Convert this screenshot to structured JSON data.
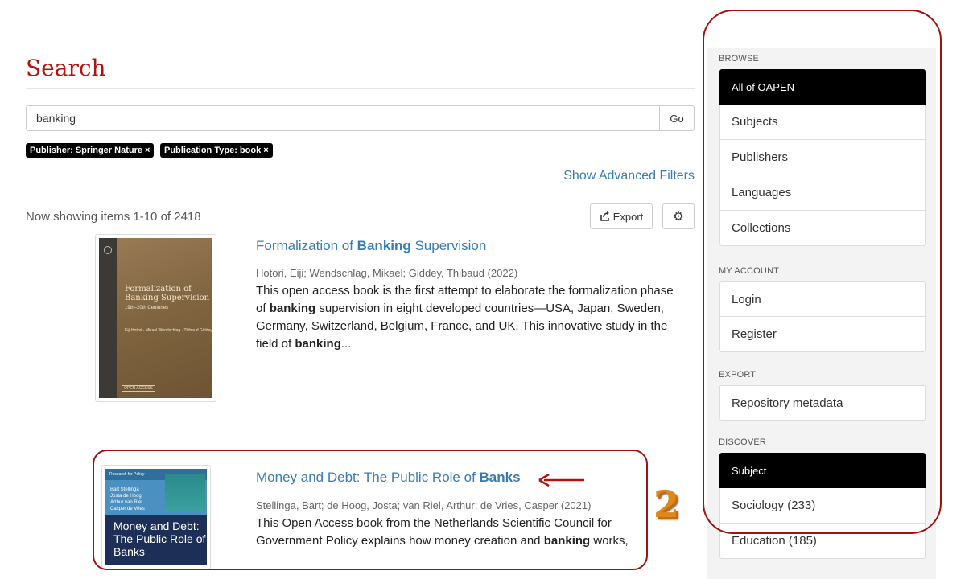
{
  "header": {
    "title": "Search"
  },
  "search": {
    "value": "banking",
    "go_label": "Go"
  },
  "filters": [
    {
      "label": "Publisher: Springer Nature ×"
    },
    {
      "label": "Publication Type: book ×"
    }
  ],
  "advanced_filters_label": "Show Advanced Filters",
  "results_info": "Now showing items 1-10 of 2418",
  "toolbar": {
    "export_label": "Export"
  },
  "results": [
    {
      "title_pre": "Formalization of ",
      "title_bold": "Banking",
      "title_post": " Supervision",
      "meta": "Hotori, Eiji; Wendschlag, Mikael; Giddey, Thibaud (2022)",
      "abstract_1": "This open access book is the first attempt to elaborate the formalization phase of ",
      "abstract_b1": "banking",
      "abstract_2": " supervision in eight developed countries—USA, Japan, Sweden, Germany, Switzerland, Belgium, France, and UK. This innovative study in the field of ",
      "abstract_b2": "banking",
      "abstract_3": "...",
      "cover": {
        "title": "Formalization of Banking Supervision",
        "subtitle": "19th–20th Centuries",
        "authors": "Eiji Hotori · Mikael Wendschlag · Thibaud Giddey",
        "badge": "OPEN ACCESS"
      }
    },
    {
      "title_pre": "Money and Debt: The Public Role of ",
      "title_bold": "Banks",
      "meta": "Stellinga, Bart; de Hoog, Josta; van Riel, Arthur; de Vries, Casper (2021)",
      "abstract_1": "This Open Access book from the Netherlands Scientific Council for Government Policy explains how money creation and ",
      "abstract_b1": "banking",
      "abstract_2": " works,",
      "cover": {
        "series": "Research for Policy",
        "authors": "Bart Stellinga\nJosta de Hoog\nArthur van Riel\nCasper de Vries",
        "title": "Money and Debt: The Public Role of Banks"
      }
    }
  ],
  "sidebar": {
    "browse_heading": "BROWSE",
    "browse_items": [
      "All of OAPEN",
      "Subjects",
      "Publishers",
      "Languages",
      "Collections"
    ],
    "account_heading": "MY ACCOUNT",
    "account_items": [
      "Login",
      "Register"
    ],
    "export_heading": "EXPORT",
    "export_items": [
      "Repository metadata"
    ],
    "discover_heading": "DISCOVER",
    "discover_items": [
      "Subject",
      "Sociology (233)",
      "Education (185)"
    ]
  },
  "annotation": {
    "number": "2"
  },
  "colors": {
    "title_red": "#b3130f",
    "link_blue": "#3a7cb0",
    "annotation_red": "#a01010",
    "annotation_orange": "#e0871a"
  }
}
